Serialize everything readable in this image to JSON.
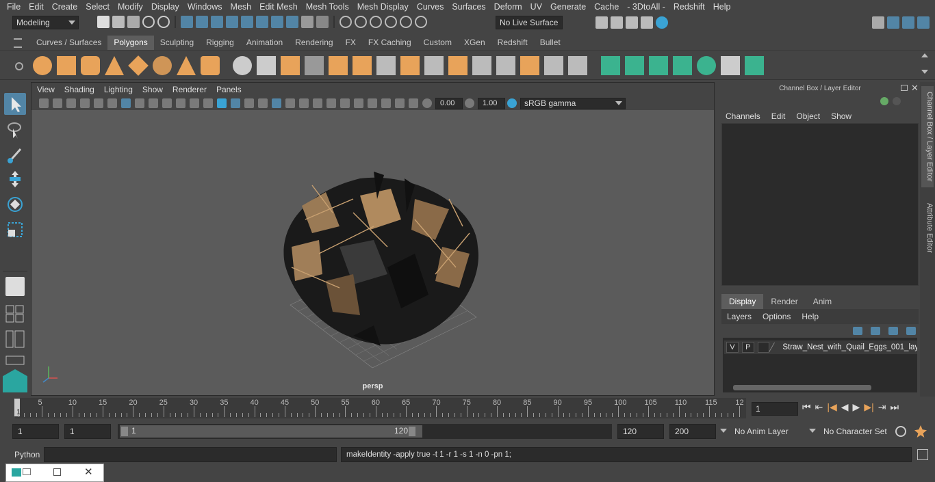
{
  "menubar": {
    "items": [
      "File",
      "Edit",
      "Create",
      "Select",
      "Modify",
      "Display",
      "Windows",
      "Mesh",
      "Edit Mesh",
      "Mesh Tools",
      "Mesh Display",
      "Curves",
      "Surfaces",
      "Deform",
      "UV",
      "Generate",
      "Cache",
      "- 3DtoAll -",
      "Redshift",
      "Help"
    ]
  },
  "statusline": {
    "workspace": "Modeling",
    "live_surface": "No Live Surface"
  },
  "shelf": {
    "tabs": [
      "Curves / Surfaces",
      "Polygons",
      "Sculpting",
      "Rigging",
      "Animation",
      "Rendering",
      "FX",
      "FX Caching",
      "Custom",
      "XGen",
      "Redshift",
      "Bullet"
    ],
    "active_tab": "Polygons"
  },
  "viewport": {
    "menu": [
      "View",
      "Shading",
      "Lighting",
      "Show",
      "Renderer",
      "Panels"
    ],
    "exposure": "0.00",
    "gamma": "1.00",
    "color_space": "sRGB gamma",
    "camera": "persp"
  },
  "channel_box": {
    "title": "Channel Box / Layer Editor",
    "menu": [
      "Channels",
      "Edit",
      "Object",
      "Show"
    ]
  },
  "layer_editor": {
    "tabs": [
      "Display",
      "Render",
      "Anim"
    ],
    "active_tab": "Display",
    "menu": [
      "Layers",
      "Options",
      "Help"
    ],
    "layer": {
      "v": "V",
      "p": "P",
      "name": "Straw_Nest_with_Quail_Eggs_001_lay"
    }
  },
  "side_tabs": [
    "Channel Box / Layer Editor",
    "Attribute Editor"
  ],
  "timeslider": {
    "ticks": [
      "5",
      "10",
      "15",
      "20",
      "25",
      "30",
      "35",
      "40",
      "45",
      "50",
      "55",
      "60",
      "65",
      "70",
      "75",
      "80",
      "85",
      "90",
      "95",
      "100",
      "105",
      "110",
      "115",
      "12"
    ],
    "start_label": "1",
    "current_frame": "1"
  },
  "range": {
    "start": "1",
    "playback_start": "1",
    "slider_start": "1",
    "slider_end": "120",
    "playback_end": "120",
    "end": "200",
    "anim_layer": "No Anim Layer",
    "char_set": "No Character Set"
  },
  "command": {
    "lang": "Python",
    "result": "makeIdentity -apply true -t 1 -r 1 -s 1 -n 0 -pn 1;"
  },
  "colors": {
    "accent": "#5285a6",
    "shelf_orange": "#e8a35a",
    "shelf_green": "#3bb38f",
    "bg": "#444444"
  }
}
